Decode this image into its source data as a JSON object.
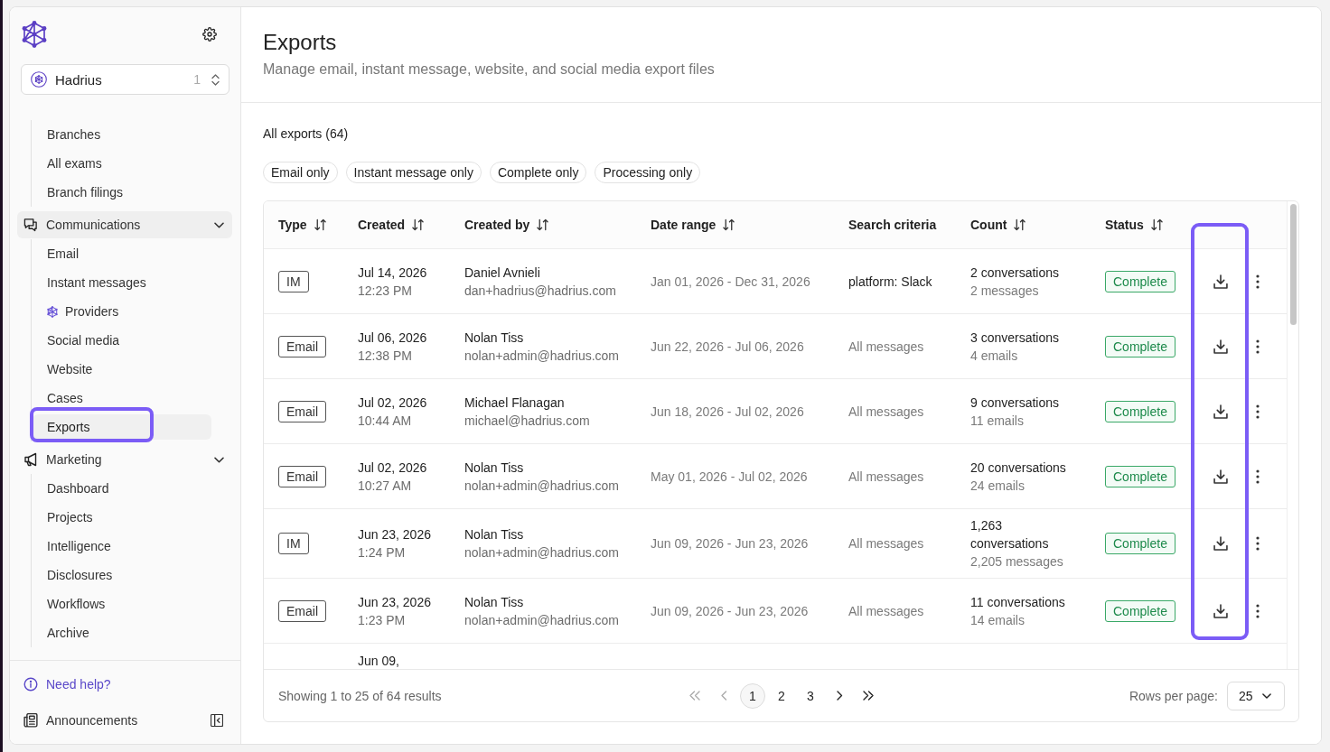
{
  "sidebar": {
    "org_selector": {
      "name": "Hadrius",
      "count": "1"
    },
    "nav": [
      {
        "children": [
          {
            "label": "Branches",
            "kind": "plain",
            "selected": false,
            "outlined": false
          },
          {
            "label": "All exams",
            "kind": "plain",
            "selected": false,
            "outlined": false
          },
          {
            "label": "Branch filings",
            "kind": "plain",
            "selected": false,
            "outlined": false
          }
        ]
      },
      {
        "label": "Communications",
        "active": true,
        "expanded": true,
        "children": [
          {
            "label": "Email",
            "kind": "plain",
            "selected": false,
            "outlined": false
          },
          {
            "label": "Instant messages",
            "kind": "plain",
            "selected": false,
            "outlined": false
          },
          {
            "label": "Providers",
            "kind": "branded",
            "selected": false,
            "outlined": false
          },
          {
            "label": "Social media",
            "kind": "plain",
            "selected": false,
            "outlined": false
          },
          {
            "label": "Website",
            "kind": "plain",
            "selected": false,
            "outlined": false
          },
          {
            "label": "Cases",
            "kind": "plain",
            "selected": false,
            "outlined": false
          },
          {
            "label": "Exports",
            "kind": "plain",
            "selected": true,
            "outlined": true
          }
        ]
      },
      {
        "label": "Marketing",
        "active": false,
        "expanded": true,
        "children": [
          {
            "label": "Dashboard",
            "kind": "plain",
            "selected": false,
            "outlined": false
          },
          {
            "label": "Projects",
            "kind": "plain",
            "selected": false,
            "outlined": false
          },
          {
            "label": "Intelligence",
            "kind": "plain",
            "selected": false,
            "outlined": false
          },
          {
            "label": "Disclosures",
            "kind": "plain",
            "selected": false,
            "outlined": false
          },
          {
            "label": "Workflows",
            "kind": "plain",
            "selected": false,
            "outlined": false
          },
          {
            "label": "Archive",
            "kind": "plain",
            "selected": false,
            "outlined": false
          }
        ]
      }
    ],
    "footer": [
      {
        "kind": "link",
        "label": "Need help?"
      },
      {
        "kind": "item",
        "label": "Announcements"
      }
    ]
  },
  "page": {
    "title": "Exports",
    "subtitle": "Manage email, instant message, website, and social media export files"
  },
  "filters": {
    "heading": "All exports (64)",
    "chips": [
      {
        "label": "Email only",
        "selected": false
      },
      {
        "label": "Instant message only",
        "selected": false
      },
      {
        "label": "Complete only",
        "selected": false
      },
      {
        "label": "Processing only",
        "selected": false
      }
    ]
  },
  "table": {
    "columns": [
      {
        "label": "Type",
        "sortable": true
      },
      {
        "label": "Created",
        "sortable": true
      },
      {
        "label": "Created by",
        "sortable": true
      },
      {
        "label": "Date range",
        "sortable": true
      },
      {
        "label": "Search criteria",
        "sortable": false
      },
      {
        "label": "Count",
        "sortable": true
      },
      {
        "label": "Status",
        "sortable": true
      }
    ],
    "download_column_outlined": true,
    "rows": [
      {
        "kind": "full",
        "type": "IM",
        "created_date": "Jul 14, 2026",
        "created_time": "12:23 PM",
        "creator_name": "Daniel Avnieli",
        "creator_email": "dan+hadrius@hadrius.com",
        "date_range": "Jan 01, 2026 - Dec 31, 2026",
        "search_criteria": {
          "text": "platform: Slack",
          "kind": "custom"
        },
        "count_primary": "2 conversations",
        "count_secondary": "2 messages",
        "status": {
          "label": "Complete",
          "kind": "complete"
        }
      },
      {
        "kind": "full",
        "type": "Email",
        "created_date": "Jul 06, 2026",
        "created_time": "12:38 PM",
        "creator_name": "Nolan Tiss",
        "creator_email": "nolan+admin@hadrius.com",
        "date_range": "Jun 22, 2026 - Jul 06, 2026",
        "search_criteria": {
          "text": "All messages",
          "kind": "default"
        },
        "count_primary": "3 conversations",
        "count_secondary": "4 emails",
        "status": {
          "label": "Complete",
          "kind": "complete"
        }
      },
      {
        "kind": "full",
        "type": "Email",
        "created_date": "Jul 02, 2026",
        "created_time": "10:44 AM",
        "creator_name": "Michael Flanagan",
        "creator_email": "michael@hadrius.com",
        "date_range": "Jun 18, 2026 - Jul 02, 2026",
        "search_criteria": {
          "text": "All messages",
          "kind": "default"
        },
        "count_primary": "9 conversations",
        "count_secondary": "11 emails",
        "status": {
          "label": "Complete",
          "kind": "complete"
        }
      },
      {
        "kind": "full",
        "type": "Email",
        "created_date": "Jul 02, 2026",
        "created_time": "10:27 AM",
        "creator_name": "Nolan Tiss",
        "creator_email": "nolan+admin@hadrius.com",
        "date_range": "May 01, 2026 - Jul 02, 2026",
        "search_criteria": {
          "text": "All messages",
          "kind": "default"
        },
        "count_primary": "20 conversations",
        "count_secondary": "24 emails",
        "status": {
          "label": "Complete",
          "kind": "complete"
        }
      },
      {
        "kind": "full",
        "type": "IM",
        "created_date": "Jun 23, 2026",
        "created_time": "1:24 PM",
        "creator_name": "Nolan Tiss",
        "creator_email": "nolan+admin@hadrius.com",
        "date_range": "Jun 09, 2026 - Jun 23, 2026",
        "search_criteria": {
          "text": "All messages",
          "kind": "default"
        },
        "count_primary": "1,263 conversations",
        "count_secondary": "2,205 messages",
        "status": {
          "label": "Complete",
          "kind": "complete"
        }
      },
      {
        "kind": "full",
        "type": "Email",
        "created_date": "Jun 23, 2026",
        "created_time": "1:23 PM",
        "creator_name": "Nolan Tiss",
        "creator_email": "nolan+admin@hadrius.com",
        "date_range": "Jun 09, 2026 - Jun 23, 2026",
        "search_criteria": {
          "text": "All messages",
          "kind": "default"
        },
        "count_primary": "11 conversations",
        "count_secondary": "14 emails",
        "status": {
          "label": "Complete",
          "kind": "complete"
        }
      },
      {
        "kind": "partial",
        "created_date": "Jun 09,"
      }
    ]
  },
  "pagination": {
    "summary": "Showing 1 to 25 of 64 results",
    "controls": [
      {
        "kind": "first",
        "disabled": true
      },
      {
        "kind": "previous",
        "disabled": true
      },
      {
        "kind": "next",
        "disabled": false
      },
      {
        "kind": "last",
        "disabled": false
      }
    ],
    "pages": [
      {
        "label": "1",
        "selected": true
      },
      {
        "label": "2",
        "selected": false
      },
      {
        "label": "3",
        "selected": false
      }
    ],
    "rows_per_page_label": "Rows per page:",
    "rows_per_page": "25"
  }
}
